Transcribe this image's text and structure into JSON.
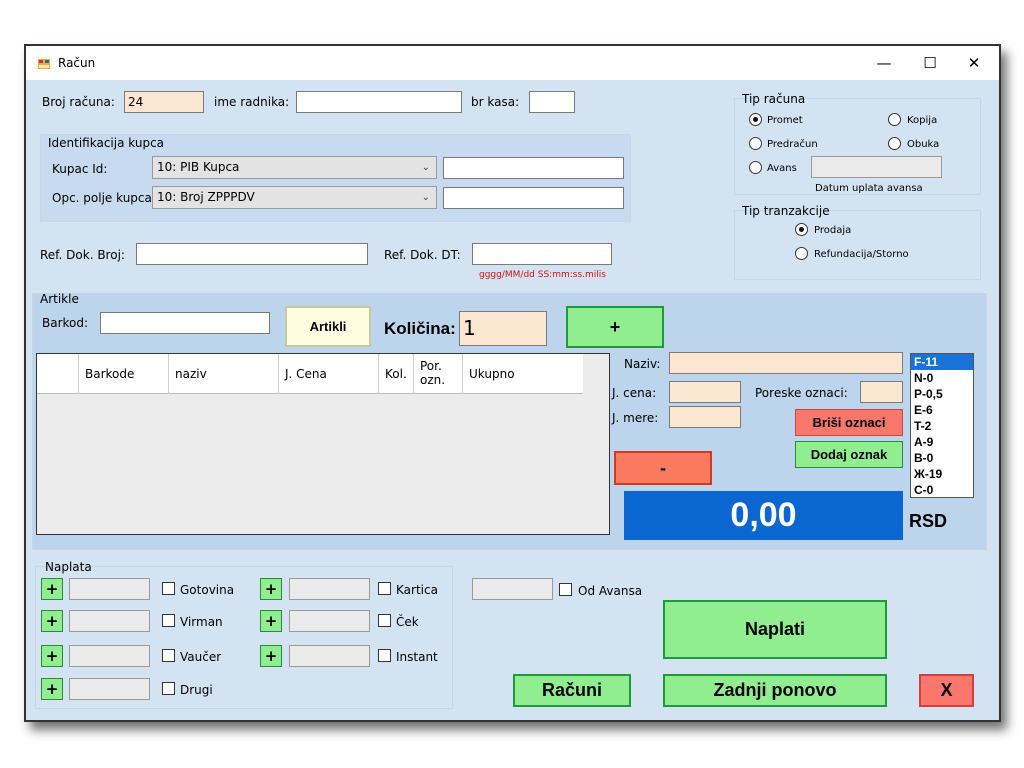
{
  "window": {
    "title": "Račun",
    "minimize": "—",
    "maximize": "☐",
    "close": "✕"
  },
  "header": {
    "broj_racuna_label": "Broj računa:",
    "broj_racuna_value": "24",
    "ime_radnika_label": "ime radnika:",
    "ime_radnika_value": "",
    "br_kasa_label": "br kasa:",
    "br_kasa_value": ""
  },
  "kupac": {
    "group_title": "Identifikacija kupca",
    "kupac_id_label": "Kupac Id:",
    "kupac_id_selected": "10: PIB Kupca",
    "kupac_id_value": "",
    "opc_label": "Opc. polje kupca:",
    "opc_selected": "10: Broj ZPPPDV",
    "opc_value": ""
  },
  "ref": {
    "broj_label": "Ref. Dok. Broj:",
    "broj_value": "",
    "dt_label": "Ref. Dok. DT:",
    "dt_value": "",
    "dt_hint": "gggg/MM/dd SS:mm:ss.milis"
  },
  "tip_racuna": {
    "title": "Tip računa",
    "options": [
      "Promet",
      "Kopija",
      "Predračun",
      "Obuka",
      "Avans"
    ],
    "selected": "Promet",
    "avans_value": "",
    "datum_label": "Datum uplata avansa"
  },
  "tip_tranzakcije": {
    "title": "Tip tranzakcije",
    "options": [
      "Prodaja",
      "Refundacija/Storno"
    ],
    "selected": "Prodaja"
  },
  "artikle": {
    "group_title": "Artikle",
    "barkod_label": "Barkod:",
    "barkod_value": "",
    "artikli_button": "Artikli",
    "kolicina_label": "Količina:",
    "kolicina_value": "1",
    "plus_button": "+",
    "minus_button": "-"
  },
  "table": {
    "columns": [
      "",
      "Barkode",
      "naziv",
      "J. Cena",
      "Kol.",
      "Por.\nozn.",
      "Ukupno"
    ],
    "rows": []
  },
  "item_detail": {
    "naziv_label": "Naziv:",
    "j_cena_label": "J. cena:",
    "j_mere_label": "J. mere:",
    "poreske_label": "Poreske oznaci:",
    "brisi_button": "Briši oznaci",
    "dodaj_button": "Dodaj oznak"
  },
  "tax_codes": {
    "items": [
      "F-11",
      "N-0",
      "P-0,5",
      "E-6",
      "T-2",
      "A-9",
      "B-0",
      "Ж-19",
      "C-0"
    ],
    "selected": "F-11"
  },
  "totals": {
    "amount": "0,00",
    "currency": "RSD"
  },
  "naplata": {
    "group_title": "Naplata",
    "methods": [
      "Gotovina",
      "Virman",
      "Vaučer",
      "Drugi",
      "Kartica",
      "Ček",
      "Instant"
    ],
    "od_avansa_label": "Od Avansa",
    "plus": "+"
  },
  "actions": {
    "naplati": "Naplati",
    "racuni": "Računi",
    "zadnji_ponovo": "Zadnji ponovo",
    "close": "X"
  },
  "colors": {
    "window_bg": "#d4e3f2",
    "peach": "#fbe6d2",
    "green": "#90ee90",
    "red": "#f8766a",
    "total_blue": "#0a66d0",
    "selection_blue": "#1a73d6"
  }
}
